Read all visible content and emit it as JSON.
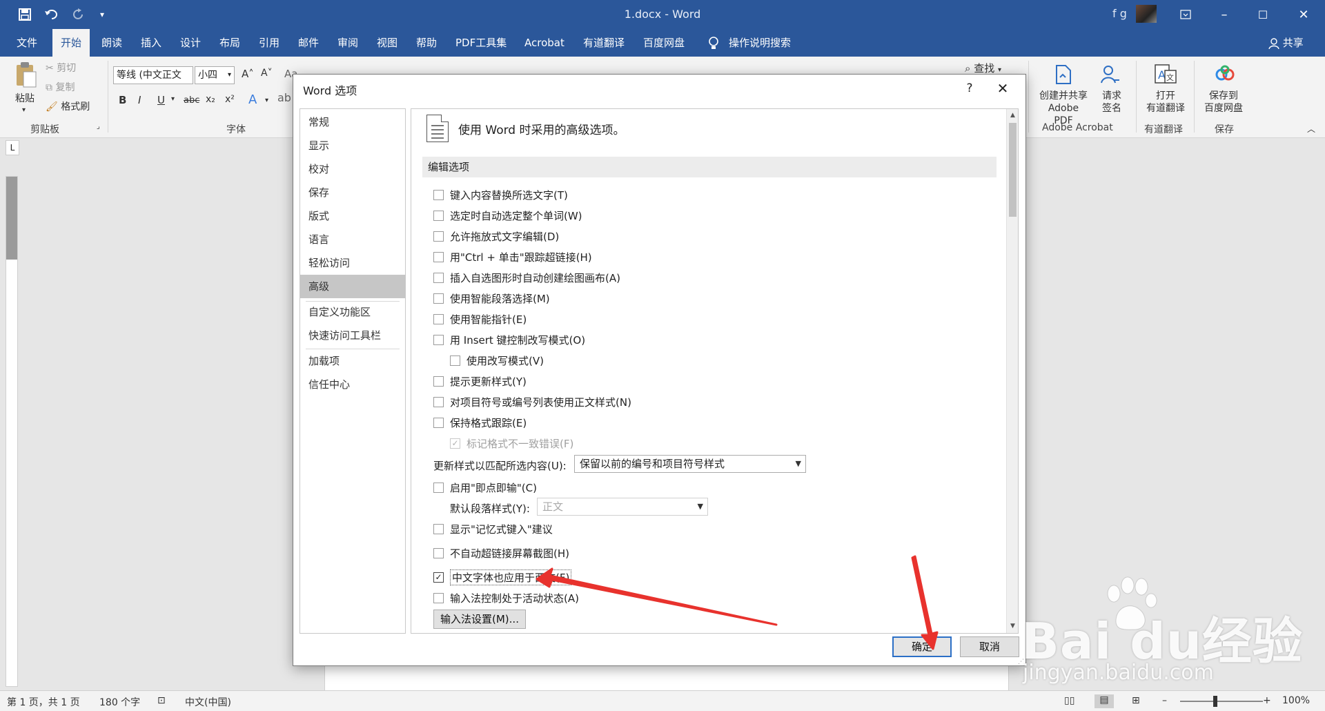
{
  "window": {
    "title": "1.docx  -  Word",
    "user": "f g"
  },
  "quick_access": {
    "save_icon": "save-icon",
    "undo_icon": "undo-icon",
    "redo_icon": "redo-icon",
    "customize_icon": "customize-qat-icon"
  },
  "window_controls": {
    "ribbon_options": "ribbon-display-icon",
    "minimize": "–",
    "restore": "☐",
    "close": "✕"
  },
  "tabs": [
    "文件",
    "开始",
    "朗读",
    "插入",
    "设计",
    "布局",
    "引用",
    "邮件",
    "审阅",
    "视图",
    "帮助",
    "PDF工具集",
    "Acrobat",
    "有道翻译",
    "百度网盘",
    "操作说明搜索"
  ],
  "active_tab": "开始",
  "share": "共享",
  "ribbon": {
    "paste": "粘贴",
    "cut": "剪切",
    "copy": "复制",
    "format_painter": "格式刷",
    "clipboard_label": "剪贴板",
    "font_name": "等线 (中文正文",
    "font_size": "小四",
    "font_label": "字体",
    "find": "查找",
    "acrobat_create": "创建并共享",
    "acrobat_create2": "Adobe PDF",
    "acrobat_sign": "请求",
    "acrobat_sign2": "签名",
    "acrobat_label": "Adobe Acrobat",
    "youdao_open": "打开",
    "youdao_open2": "有道翻译",
    "youdao_label": "有道翻译",
    "baidu_save": "保存到",
    "baidu_save2": "百度网盘",
    "baidu_label": "保存"
  },
  "status": {
    "page": "第 1 页，共 1 页",
    "words": "180 个字",
    "lang": "中文(中国)",
    "zoom": "100%",
    "zoom_minus": "–",
    "zoom_plus": "+"
  },
  "dialog": {
    "title": "Word 选项",
    "help": "?",
    "close": "✕",
    "nav": [
      "常规",
      "显示",
      "校对",
      "保存",
      "版式",
      "语言",
      "轻松访问",
      "高级",
      "自定义功能区",
      "快速访问工具栏",
      "加载项",
      "信任中心"
    ],
    "selected_nav": "高级",
    "header": "使用 Word 时采用的高级选项。",
    "section": "编辑选项",
    "options": [
      {
        "label": "键入内容替换所选文字(T)",
        "checked": false
      },
      {
        "label": "选定时自动选定整个单词(W)",
        "checked": false
      },
      {
        "label": "允许拖放式文字编辑(D)",
        "checked": false
      },
      {
        "label": "用\"Ctrl + 单击\"跟踪超链接(H)",
        "checked": false
      },
      {
        "label": "插入自选图形时自动创建绘图画布(A)",
        "checked": false
      },
      {
        "label": "使用智能段落选择(M)",
        "checked": false
      },
      {
        "label": "使用智能指针(E)",
        "checked": false
      },
      {
        "label": "用 Insert 键控制改写模式(O)",
        "checked": false
      },
      {
        "label": "使用改写模式(V)",
        "checked": false
      },
      {
        "label": "提示更新样式(Y)",
        "checked": false
      },
      {
        "label": "对项目符号或编号列表使用正文样式(N)",
        "checked": false
      },
      {
        "label": "保持格式跟踪(E)",
        "checked": false
      },
      {
        "label": "标记格式不一致错误(F)",
        "checked": true
      },
      {
        "label": "启用\"即点即输\"(C)",
        "checked": false
      },
      {
        "label": "显示\"记忆式键入\"建议",
        "checked": false
      },
      {
        "label": "不自动超链接屏幕截图(H)",
        "checked": false
      },
      {
        "label": "中文字体也应用于西文(F)",
        "checked": true
      },
      {
        "label": "输入法控制处于活动状态(A)",
        "checked": false
      }
    ],
    "update_style_label": "更新样式以匹配所选内容(U):",
    "update_style_value": "保留以前的编号和项目符号样式",
    "default_para_label": "默认段落样式(Y):",
    "default_para_value": "正文",
    "ime_button": "输入法设置(M)...",
    "ok": "确定",
    "cancel": "取消"
  },
  "watermark": {
    "brand": "Bai du经验",
    "url": "jingyan.baidu.com"
  },
  "colors": {
    "accent": "#2b579a",
    "annotation": "#e8322d"
  }
}
